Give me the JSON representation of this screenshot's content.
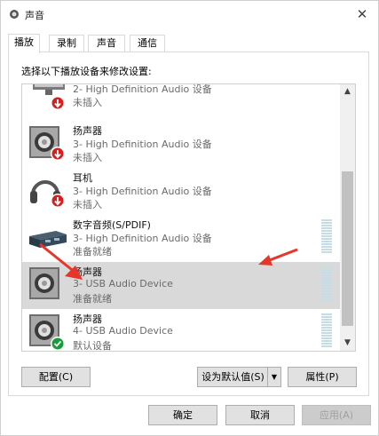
{
  "window": {
    "title": "声音",
    "close_glyph": "✕"
  },
  "tabs": [
    {
      "label": "播放",
      "active": true
    },
    {
      "label": "录制",
      "active": false
    },
    {
      "label": "声音",
      "active": false
    },
    {
      "label": "通信",
      "active": false
    }
  ],
  "panel": {
    "instruction": "选择以下播放设备来修改设置:"
  },
  "devices": [
    {
      "name": "",
      "desc": "2- High Definition Audio 设备",
      "status": "未插入",
      "icon": "monitor-icon",
      "badge": "unplugged",
      "selected": false
    },
    {
      "name": "扬声器",
      "desc": "3- High Definition Audio 设备",
      "status": "未插入",
      "icon": "speaker-icon",
      "badge": "unplugged",
      "selected": false
    },
    {
      "name": "耳机",
      "desc": "3- High Definition Audio 设备",
      "status": "未插入",
      "icon": "headphones-icon",
      "badge": "unplugged",
      "selected": false
    },
    {
      "name": "数字音频(S/PDIF)",
      "desc": "3- High Definition Audio 设备",
      "status": "准备就绪",
      "icon": "spdif-icon",
      "badge": "none",
      "selected": false,
      "meter": true
    },
    {
      "name": "扬声器",
      "desc": "3- USB Audio Device",
      "status": "准备就绪",
      "icon": "speaker-icon",
      "badge": "none",
      "selected": true,
      "meter": true
    },
    {
      "name": "扬声器",
      "desc": "4- USB Audio Device",
      "status": "默认设备",
      "icon": "speaker-icon",
      "badge": "default",
      "selected": false,
      "meter": true
    }
  ],
  "buttons": {
    "configure": "配置(C)",
    "set_default": "设为默认值(S)",
    "properties": "属性(P)",
    "ok": "确定",
    "cancel": "取消",
    "apply": "应用(A)"
  },
  "colors": {
    "annotation_arrow": "#e8352a",
    "selected_row": "#d9d9d9",
    "default_badge": "#1a9c3a",
    "unplugged_badge": "#d42020"
  }
}
